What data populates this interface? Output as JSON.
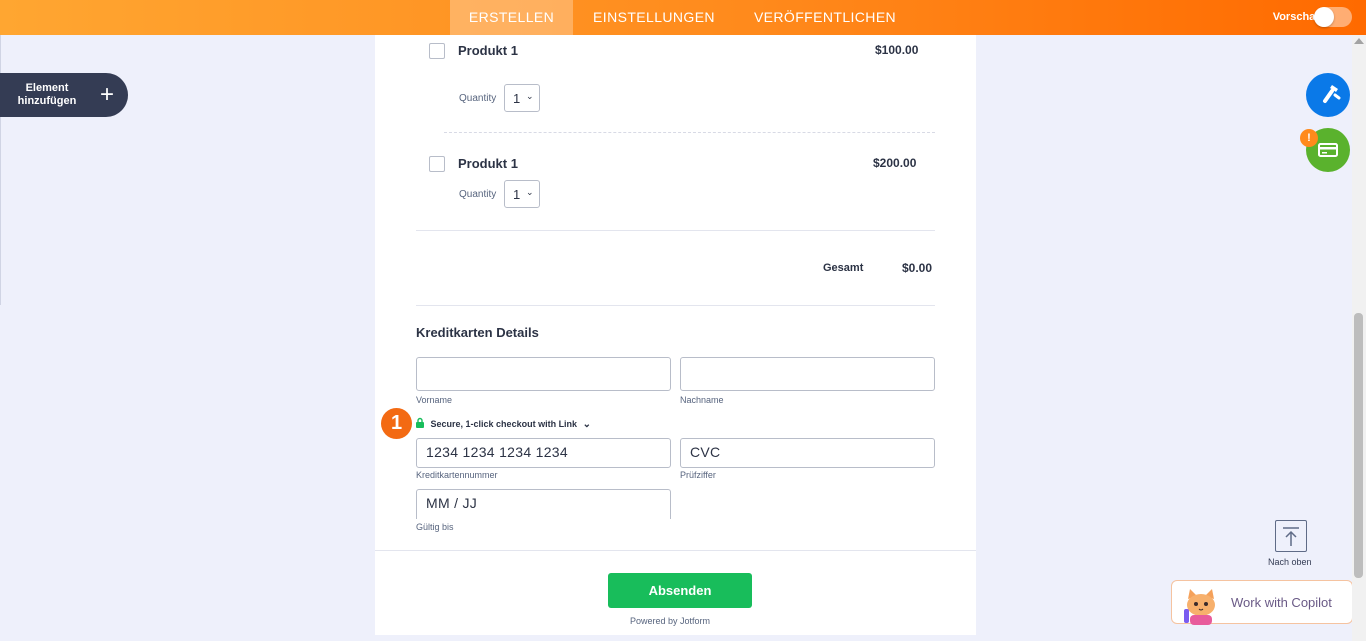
{
  "topbar": {
    "tabs": [
      {
        "label": "ERSTELLEN"
      },
      {
        "label": "EINSTELLUNGEN"
      },
      {
        "label": "VERÖFFENTLICHEN"
      }
    ],
    "preview_label": "Vorschau",
    "preview_on": false
  },
  "sidebar": {
    "add_element_line1": "Element",
    "add_element_line2": "hinzufügen"
  },
  "form": {
    "products": [
      {
        "name": "Produkt 1",
        "price": "$100.00",
        "qty_label": "Quantity",
        "qty_value": "1"
      },
      {
        "name": "Produkt 1",
        "price": "$200.00",
        "qty_label": "Quantity",
        "qty_value": "1"
      }
    ],
    "total_label": "Gesamt",
    "total_value": "$0.00",
    "cc_title": "Kreditkarten Details",
    "first_name_label": "Vorname",
    "last_name_label": "Nachname",
    "link_text": "Secure, 1-click checkout with Link",
    "card_number_placeholder": "1234 1234 1234 1234",
    "card_number_label": "Kreditkartennummer",
    "cvc_placeholder": "CVC",
    "cvc_label": "Prüfziffer",
    "expiry_placeholder": "MM / JJ",
    "expiry_label": "Gültig bis",
    "step_badge": "1",
    "submit_label": "Absenden",
    "powered_by": "Powered by Jotform"
  },
  "tools": {
    "warning_badge": "!",
    "back_to_top_label": "Nach oben",
    "copilot_label": "Work with Copilot"
  },
  "colors": {
    "accent_orange": "#ff6a00",
    "submit_green": "#18bd5b",
    "fab_blue": "#0a79e8",
    "fab_green": "#5ab22d",
    "sidebar_dark": "#343c54"
  }
}
